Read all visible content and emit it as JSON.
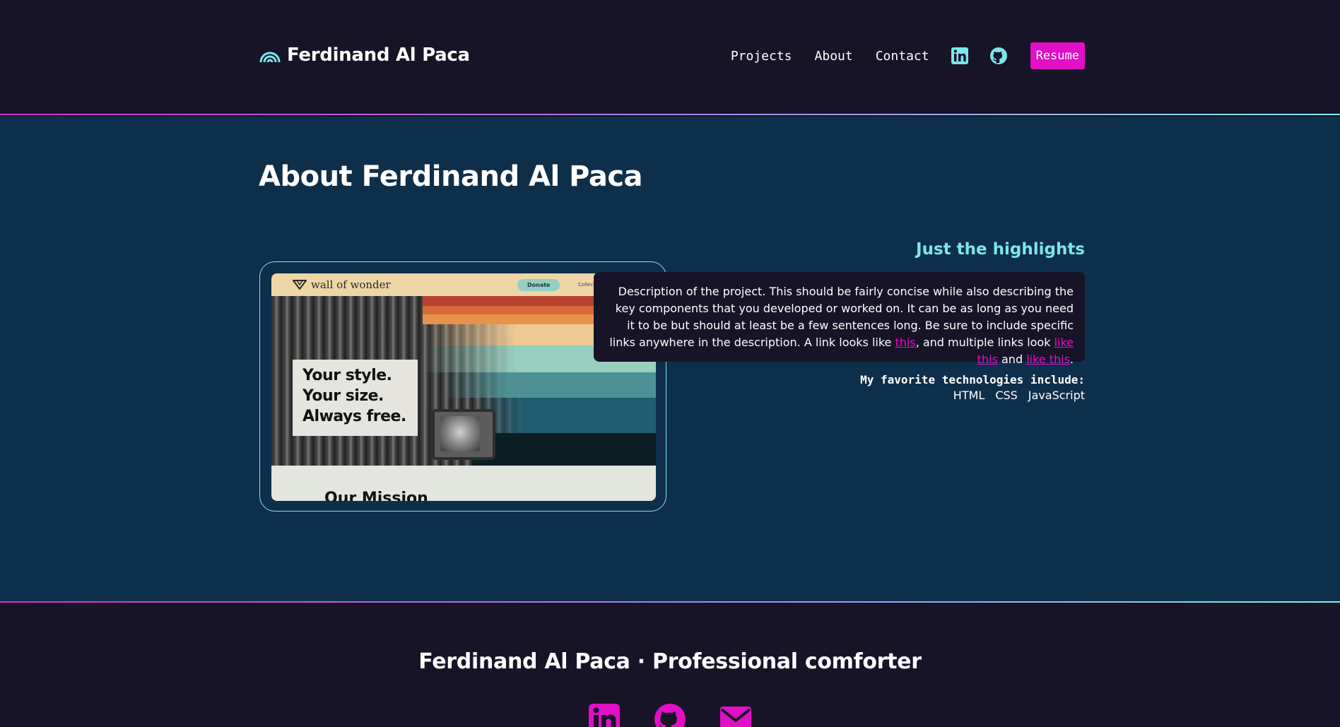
{
  "header": {
    "logo_text": "Ferdinand Al Paca",
    "logo_icon": "rainbow-icon",
    "nav": [
      {
        "label": "Projects"
      },
      {
        "label": "About"
      },
      {
        "label": "Contact"
      }
    ],
    "social_icons": [
      "linkedin-icon",
      "github-icon"
    ],
    "resume_label": "Resume"
  },
  "main": {
    "title": "About Ferdinand Al Paca",
    "screenshot": {
      "brand": "wall of wonder",
      "donate_label": "Donate",
      "nav_hint": "Collect",
      "hero_lines": [
        "Your style.",
        "Your size.",
        "Always free."
      ],
      "section_heading": "Our Mission"
    },
    "highlights_title": "Just the highlights",
    "description": {
      "text": "Description of the project. This should be fairly concise while also describing the key components that you developed or worked on. It can be as long as you need it to be but should at least be a few sentences long. Be sure to include specific links anywhere in the description. A link looks like ",
      "link1": "this",
      "middle": ", and multiple links look ",
      "link2": "like this",
      "and": " and ",
      "link3": "like this",
      "end": "."
    },
    "favorites_title": "My favorite technologies include:",
    "technologies": [
      "HTML",
      "CSS",
      "JavaScript"
    ]
  },
  "footer": {
    "title": "Ferdinand Al Paca · Professional comforter",
    "icons": [
      "linkedin-icon",
      "github-icon",
      "email-icon"
    ]
  },
  "colors": {
    "background": "#171427",
    "main_background": "#0e2f4a",
    "accent_pink": "#e10fc6",
    "accent_cyan": "#7ce6ec"
  }
}
